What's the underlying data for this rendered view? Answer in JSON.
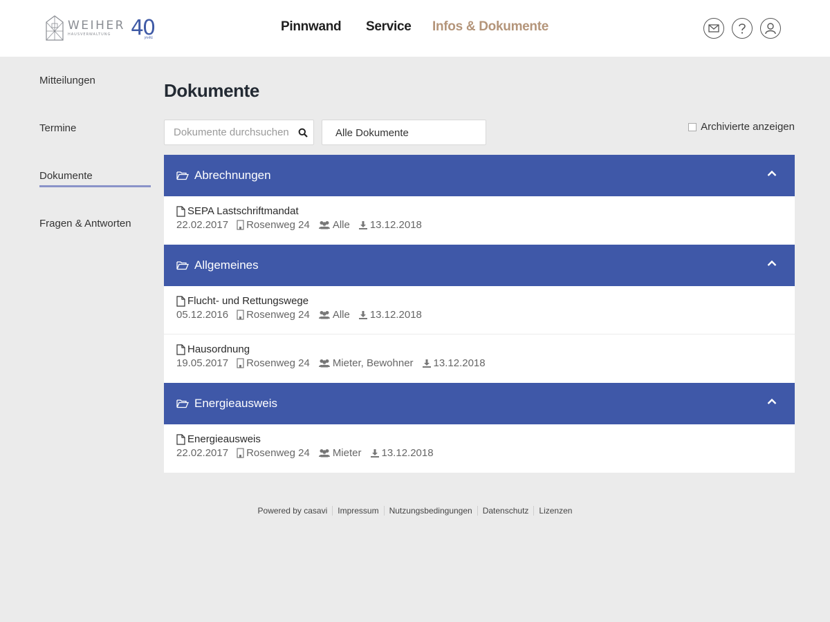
{
  "logo": {
    "word": "WEIHER",
    "sub": "HAUSVERWALTUNG",
    "anniversary": "40",
    "anniversary_sub": "JAHRE"
  },
  "nav": {
    "items": [
      {
        "label": "Pinnwand"
      },
      {
        "label": "Service"
      },
      {
        "label": "Infos & Dokumente"
      }
    ]
  },
  "header_icons": [
    "envelope-icon",
    "question-icon",
    "user-icon"
  ],
  "sidebar": {
    "items": [
      {
        "label": "Mitteilungen"
      },
      {
        "label": "Termine"
      },
      {
        "label": "Dokumente"
      },
      {
        "label": "Fragen & Antworten"
      }
    ]
  },
  "main": {
    "title": "Dokumente",
    "search_placeholder": "Dokumente durchsuchen",
    "filter_value": "Alle Dokumente",
    "archive_label": "Archivierte anzeigen"
  },
  "categories": [
    {
      "name": "Abrechnungen",
      "docs": [
        {
          "title": "SEPA Lastschriftmandat",
          "date": "22.02.2017",
          "property": "Rosenweg 24",
          "audience": "Alle",
          "download_date": "13.12.2018"
        }
      ]
    },
    {
      "name": "Allgemeines",
      "docs": [
        {
          "title": "Flucht- und Rettungswege",
          "date": "05.12.2016",
          "property": "Rosenweg 24",
          "audience": "Alle",
          "download_date": "13.12.2018"
        },
        {
          "title": "Hausordnung",
          "date": "19.05.2017",
          "property": "Rosenweg 24",
          "audience": "Mieter, Bewohner",
          "download_date": "13.12.2018"
        }
      ]
    },
    {
      "name": "Energieausweis",
      "docs": [
        {
          "title": "Energieausweis",
          "date": "22.02.2017",
          "property": "Rosenweg 24",
          "audience": "Mieter",
          "download_date": "13.12.2018"
        }
      ]
    }
  ],
  "footer": {
    "items": [
      "Powered by casavi",
      "Impressum",
      "Nutzungsbedingungen",
      "Datenschutz",
      "Lizenzen"
    ]
  },
  "colors": {
    "accent": "#3f58a8",
    "active_nav": "#b4957a",
    "background": "#ebebeb"
  }
}
